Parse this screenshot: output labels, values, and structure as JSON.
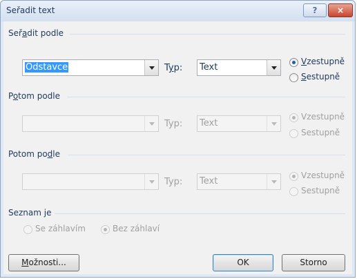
{
  "window": {
    "title": "Seřadit text",
    "help_glyph": "?",
    "close_glyph": "×"
  },
  "sort_by": {
    "label_pre": "Seř",
    "label_key": "a",
    "label_post": "dit podle",
    "field_value": "Odstavce",
    "type_label_pre": "T",
    "type_label_key": "y",
    "type_label_post": "p:",
    "type_value": "Text",
    "asc_key": "V",
    "asc_rest": "zestupně",
    "desc_key": "S",
    "desc_rest": "estupně",
    "order_selected": "asc"
  },
  "then_by_1": {
    "label_pre": "P",
    "label_key": "o",
    "label_post": "tom podle",
    "field_value": "",
    "type_label": "Typ:",
    "type_value": "Text",
    "asc": "Vzestupně",
    "desc": "Sestupně",
    "enabled": false
  },
  "then_by_2": {
    "label_pre": "Potom po",
    "label_key": "d",
    "label_post": "le",
    "field_value": "",
    "type_label": "Typ:",
    "type_value": "Text",
    "asc": "Vzestupně",
    "desc": "Sestupně",
    "enabled": false
  },
  "list": {
    "label": "Seznam je",
    "with_header": "Se záhlavím",
    "no_header": "Bez záhlaví",
    "selected": "no_header",
    "enabled": false
  },
  "buttons": {
    "options_key": "M",
    "options_rest": "ožnosti...",
    "ok": "OK",
    "cancel": "Storno"
  },
  "colors": {
    "accent": "#1e395b",
    "selection": "#3399ff",
    "disabled_text": "#a0a0a0"
  }
}
